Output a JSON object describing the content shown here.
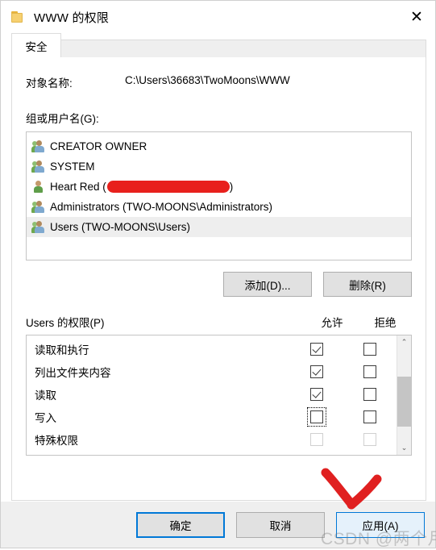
{
  "window": {
    "title": "WWW 的权限",
    "folder_icon": "folder-icon",
    "close_label": "✕"
  },
  "tabs": [
    {
      "label": "安全",
      "active": true
    }
  ],
  "object": {
    "label": "对象名称:",
    "value": "C:\\Users\\36683\\TwoMoons\\WWW"
  },
  "group_section": {
    "label": "组或用户名(G):",
    "items": [
      {
        "name": "CREATOR OWNER",
        "icon": "group-icon",
        "selected": false,
        "redacted": false
      },
      {
        "name": "SYSTEM",
        "icon": "group-icon",
        "selected": false,
        "redacted": false
      },
      {
        "name": "Heart Red (",
        "name_suffix": ")",
        "icon": "user-icon",
        "selected": false,
        "redacted": true
      },
      {
        "name": "Administrators (TWO-MOONS\\Administrators)",
        "icon": "group-icon",
        "selected": false,
        "redacted": false
      },
      {
        "name": "Users (TWO-MOONS\\Users)",
        "icon": "group-icon",
        "selected": true,
        "redacted": false
      }
    ],
    "add_button": "添加(D)...",
    "remove_button": "删除(R)"
  },
  "permissions": {
    "title": "Users 的权限(P)",
    "col_allow": "允许",
    "col_deny": "拒绝",
    "rows": [
      {
        "name": "读取和执行",
        "allow": true,
        "deny": false,
        "disabled": false,
        "focused": false
      },
      {
        "name": "列出文件夹内容",
        "allow": true,
        "deny": false,
        "disabled": false,
        "focused": false
      },
      {
        "name": "读取",
        "allow": true,
        "deny": false,
        "disabled": false,
        "focused": false
      },
      {
        "name": "写入",
        "allow": false,
        "deny": false,
        "disabled": false,
        "focused": true
      },
      {
        "name": "特殊权限",
        "allow": false,
        "deny": false,
        "disabled": true,
        "focused": false
      }
    ],
    "scroll_up": "⌃",
    "scroll_down": "⌄"
  },
  "footer": {
    "ok": "确定",
    "cancel": "取消",
    "apply": "应用(A)"
  },
  "annotations": {
    "arrow_color": "#e02020",
    "watermark": "CSDN @两个月亮"
  },
  "colors": {
    "accent": "#0078d7",
    "button_face": "#e1e1e1",
    "dialog_face": "#efefef",
    "redaction": "#e8201c",
    "selection": "#eeeeee"
  }
}
